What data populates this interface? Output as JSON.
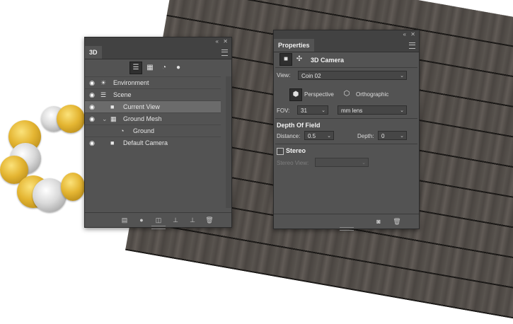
{
  "panel_3d": {
    "tab": "3D",
    "collapse": "«",
    "close": "✕",
    "filter_icons": [
      {
        "name": "scene-filter-icon",
        "glyph": "☰"
      },
      {
        "name": "mesh-filter-icon",
        "glyph": "▦"
      },
      {
        "name": "material-filter-icon",
        "glyph": "◔"
      },
      {
        "name": "light-filter-icon",
        "glyph": "●"
      }
    ],
    "layers": [
      {
        "label": "Environment",
        "glyph": "☀",
        "eye": "◉",
        "selected": false
      },
      {
        "label": "Scene",
        "glyph": "☰",
        "eye": "◉",
        "selected": false
      },
      {
        "label": "Current View",
        "glyph": "■",
        "eye": "◉",
        "selected": true
      },
      {
        "label": "Ground Mesh",
        "glyph": "▦",
        "eye": "◉",
        "expand": "⌄",
        "selected": false
      },
      {
        "label": "Ground",
        "glyph": "◔",
        "eye": "",
        "selected": false
      },
      {
        "label": "Default Camera",
        "glyph": "■",
        "eye": "◉",
        "selected": false
      }
    ],
    "bottom_icons": [
      "▤",
      "●",
      "◫",
      "⊥",
      "⊥",
      "🗑"
    ]
  },
  "properties": {
    "tab": "Properties",
    "collapse": "«",
    "close": "✕",
    "header_title": "3D Camera",
    "view_label": "View:",
    "view_value": "Coin 02",
    "perspective": "Perspective",
    "orthographic": "Orthographic",
    "fov_label": "FOV:",
    "fov_value": "31",
    "lens_value": "mm lens",
    "depth_of_field": "Depth Of Field",
    "distance_label": "Distance:",
    "distance_value": "0.5",
    "depth_label": "Depth:",
    "depth_value": "0",
    "stereo": "Stereo",
    "stereo_view_label": "Stereo View:",
    "stereo_view_value": ""
  }
}
